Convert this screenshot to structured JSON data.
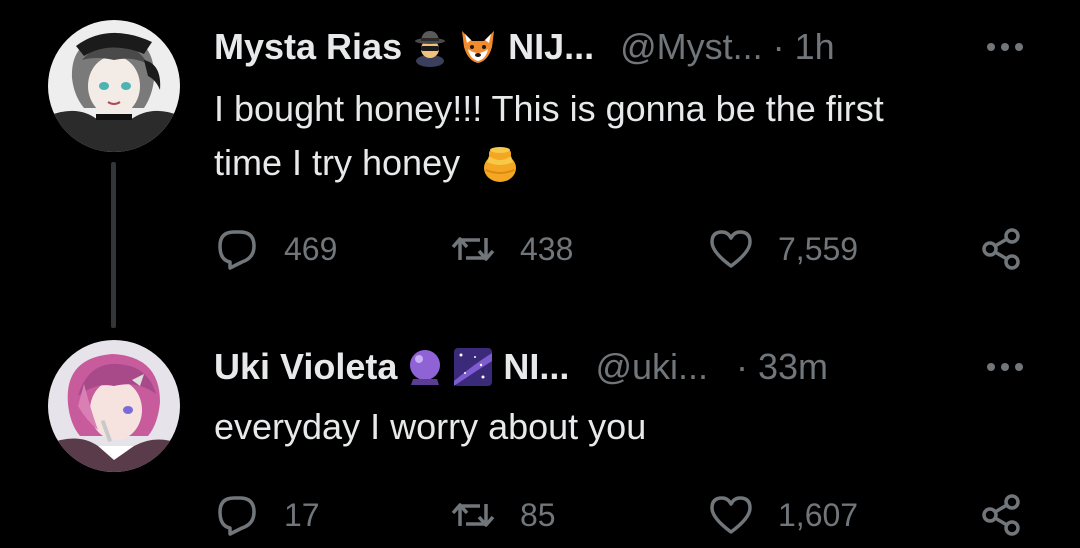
{
  "tweets": [
    {
      "display_name": "Mysta Rias",
      "emojis": [
        "detective-emoji",
        "fox-emoji"
      ],
      "affiliation": "NIJ...",
      "handle": "@Myst...",
      "time": "· 1h",
      "text_lines": [
        "I bought honey!!! This is gonna be the first",
        "time I try honey"
      ],
      "trailing_emoji": "honey-pot-emoji",
      "replies": "469",
      "retweets": "438",
      "likes": "7,559"
    },
    {
      "display_name": "Uki Violeta",
      "emojis": [
        "crystal-ball-emoji",
        "milky-way-emoji"
      ],
      "affiliation": "NI...",
      "handle": "@uki...",
      "time": "· 33m",
      "text_lines": [
        "everyday I worry about you"
      ],
      "replies": "17",
      "retweets": "85",
      "likes": "1,607"
    }
  ],
  "colors": {
    "background": "#000000",
    "primary_text": "#e7e9ea",
    "secondary_text": "#71767b",
    "thread_line": "#333639"
  }
}
